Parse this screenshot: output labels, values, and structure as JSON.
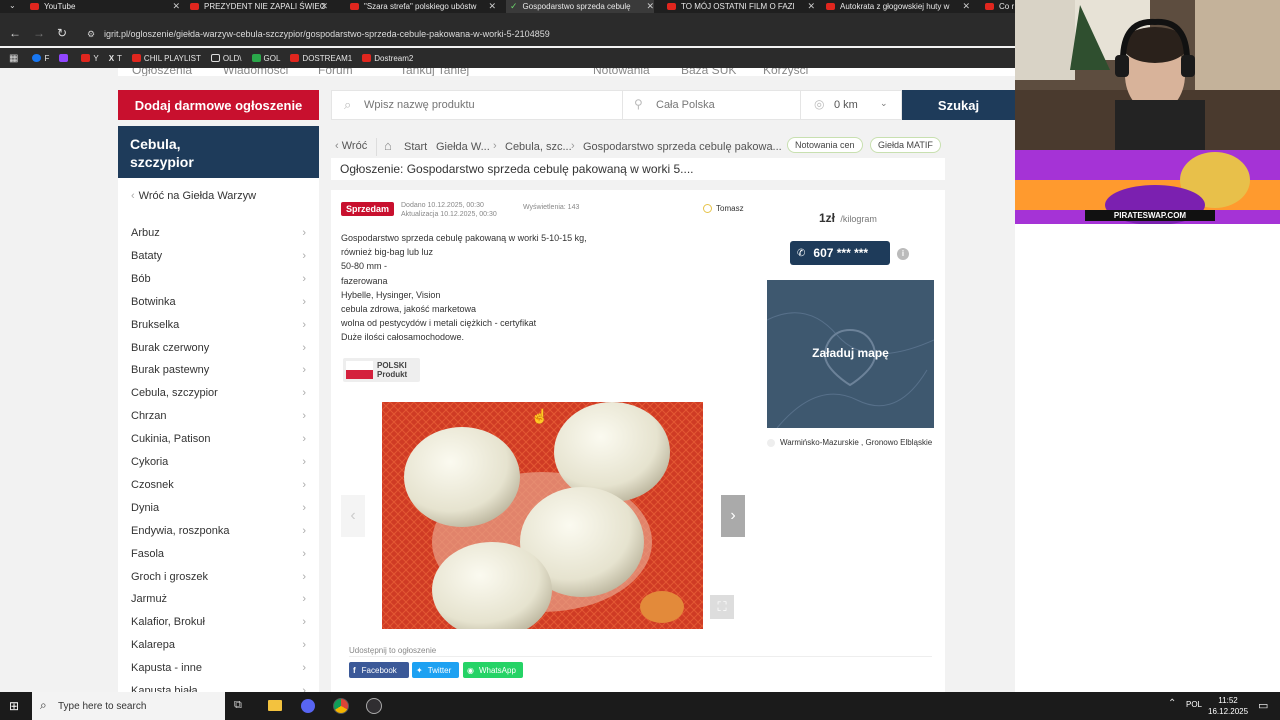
{
  "browser": {
    "tabs": [
      {
        "title": "YouTube"
      },
      {
        "title": "PREZYDENT NIE ZAPALI ŚWIEC"
      },
      {
        "title": "\"Szara strefa\" polskiego ubóstw"
      },
      {
        "title": "Gospodarstwo sprzeda cebulę"
      },
      {
        "title": "TO MÓJ OSTATNI FILM O FAZI"
      },
      {
        "title": "Autokrata z głogowskiej huty w"
      },
      {
        "title": "Co r"
      }
    ],
    "url": "igrit.pl/ogloszenie/giełda-warzyw-cebula-szczypior/gospodarstwo-sprzeda-cebule-pakowana-w-worki-5-2104859",
    "bookmarks": [
      {
        "label": "F",
        "color": "#1877f2"
      },
      {
        "label": "Y",
        "color": "#e0261e"
      },
      {
        "label": "T",
        "color": "#ffffff"
      },
      {
        "label": "CHIL PLAYLIST",
        "color": "#e0261e"
      },
      {
        "label": "OLD\\",
        "color": "#f0c000"
      },
      {
        "label": "GOL",
        "color": "#2aa84a"
      },
      {
        "label": "DOSTREAM1",
        "color": "#e0261e"
      },
      {
        "label": "Dostream2",
        "color": "#e0261e"
      }
    ]
  },
  "site": {
    "topnav": [
      "Ogłoszenia",
      "Wiadomości",
      "Forum",
      "Tańkuj Taniej",
      "Notowania",
      "Baza SUK",
      "Korzyści"
    ],
    "add_button": "Dodaj darmowe ogłoszenie",
    "search_placeholder": "Wpisz nazwę produktu",
    "location_value": "Cała Polska",
    "radius_value": "0 km",
    "search_button": "Szukaj"
  },
  "sidebar": {
    "title_line1": "Cebula,",
    "title_line2": "szczypior",
    "back_link": "Wróć na Giełda Warzyw",
    "items": [
      {
        "label": "Arbuz"
      },
      {
        "label": "Bataty"
      },
      {
        "label": "Bób"
      },
      {
        "label": "Botwinka"
      },
      {
        "label": "Brukselka"
      },
      {
        "label": "Burak czerwony"
      },
      {
        "label": "Burak pastewny"
      },
      {
        "label": "Cebula, szczypior"
      },
      {
        "label": "Chrzan"
      },
      {
        "label": "Cukinia, Patison"
      },
      {
        "label": "Cykoria"
      },
      {
        "label": "Czosnek"
      },
      {
        "label": "Dynia"
      },
      {
        "label": "Endywia, roszponka"
      },
      {
        "label": "Fasola"
      },
      {
        "label": "Groch i groszek"
      },
      {
        "label": "Jarmuż"
      },
      {
        "label": "Kalafior, Brokuł"
      },
      {
        "label": "Kalarepa"
      },
      {
        "label": "Kapusta - inne"
      },
      {
        "label": "Kapusta biała"
      }
    ]
  },
  "breadcrumb": {
    "back": "Wróć",
    "start": "Start",
    "level1": "Giełda W...",
    "level2": "Cebula, szc...",
    "level3": "Gospodarstwo sprzeda cebulę pakowa...",
    "pill1": "Notowania cen",
    "pill2": "Giełda MATIF"
  },
  "headline": "Ogłoszenie: Gospodarstwo sprzeda cebulę pakowaną w worki 5....",
  "listing": {
    "badge": "Sprzedam",
    "added": "Dodano 10.12.2025, 00:30",
    "updated": "Aktualizacja 10.12.2025, 00:30",
    "views": "Wyświetlenia: 143",
    "seller": "Tomasz",
    "price": "1zł",
    "unit": "/kilogram",
    "phone": "607 *** ***",
    "description": [
      "Gospodarstwo sprzeda cebulę pakowaną w worki 5-10-15 kg,",
      "również big-bag lub luz",
      "50-80 mm  -",
      "fazerowana",
      "Hybelle, Hysinger, Vision",
      "cebula zdrowa, jakość marketowa",
      "wolna od pestycydów i metali ciężkich - certyfikat",
      "Duże ilości całosamochodowe."
    ],
    "polish_badge_line1": "POLSKI",
    "polish_badge_line2": "Produkt",
    "map_button": "Załaduj mapę",
    "location": "Warmińsko-Mazurskie , Gronowo Elbląskie",
    "share_label": "Udostępnij to ogłoszenie",
    "share_facebook": "Facebook",
    "share_twitter": "Twitter",
    "share_whatsapp": "WhatsApp"
  },
  "overlay": {
    "promo_text": "PIRATESWAP.COM"
  },
  "taskbar": {
    "search_placeholder": "Type here to search",
    "language": "POL",
    "time": "11:52",
    "date": "16.12.2025"
  },
  "colors": {
    "brand_red": "#c8102e",
    "brand_navy": "#1e3b5a",
    "facebook": "#3b5998",
    "twitter": "#1da1f2",
    "whatsapp": "#25d366"
  }
}
